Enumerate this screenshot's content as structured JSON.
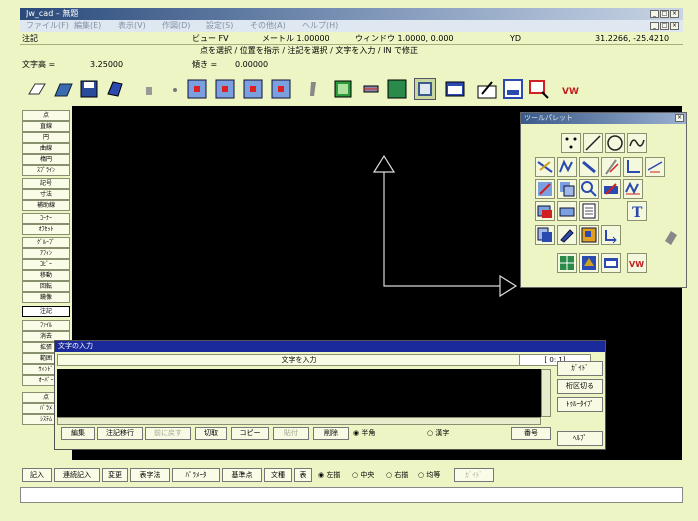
{
  "window": {
    "title": "Jw_cad – 無題",
    "menu": [
      "ファイル(F)",
      "編集(E)",
      "表示(V)",
      "作図(D)",
      "設定(S)",
      "その他(A)",
      "ヘルプ(H)"
    ],
    "min_label": "_",
    "max_label": "□",
    "close_label": "×"
  },
  "status": {
    "mode": "注記",
    "view": "ビュー FV",
    "meter": "メートル 1.00000",
    "window_size": "ウィンドウ 1.0000, 0.000",
    "coords": "31.2266, -25.4210",
    "yd": "YD",
    "prompt": "点を選択 / 位置を指示 / 注記を選択 / 文字を入力 / IN で修正",
    "text_height_label": "文字高 =",
    "text_height": "3.25000",
    "angle_label": "傾き =",
    "angle": "0.00000"
  },
  "toolbar": {
    "buttons": [
      "new-icon",
      "open-icon",
      "save-icon",
      "print-icon",
      "settings-icon",
      "pointer-icon",
      "snap-1-icon",
      "snap-2-icon",
      "snap-3-icon",
      "snap-4-icon",
      "pen-icon",
      "layer-icon",
      "grid-icon",
      "fill-icon",
      "view-icon",
      "window-icon",
      "draw-icon",
      "check-icon",
      "select-icon",
      "vw-icon"
    ],
    "accent": "#d02020"
  },
  "commands": [
    "点",
    "直線",
    "円",
    "曲線",
    "楕円",
    "ｽﾌﾟﾗｲﾝ",
    "記号",
    "寸法",
    "補助線",
    "ｺｰﾅｰ",
    "ｵﾌｾｯﾄ",
    "ｸﾞﾙｰﾌﾟ",
    "ｱﾌｨﾝ",
    "ｺﾋﾟｰ",
    "移動",
    "回転",
    "鏡像",
    "注記",
    "ﾌｧｲﾙ",
    "消去",
    "拡張",
    "範囲",
    "ｳｨﾝﾄﾞ",
    "ｵｰﾊﾞｰ",
    "点",
    "ﾊﾟﾗﾒ",
    "ｼｽﾃﾑ"
  ],
  "active_command": "注記",
  "palette": {
    "title": "ツールパレット",
    "close_label": "×",
    "tools": [
      "point-icon",
      "line-icon",
      "circle-icon",
      "curve-icon",
      "polyline-icon",
      "region-icon",
      "offset-icon",
      "trim-icon",
      "corner-icon",
      "dimension-icon",
      "move-icon",
      "copy-icon",
      "zoom-icon",
      "measure-icon",
      "symbol-icon",
      "layer-icon",
      "fill-icon",
      "hatch-icon",
      "text-icon",
      "print-icon",
      "paste-icon",
      "edit-icon",
      "undo-icon",
      "grid-icon",
      "view-icon",
      "win-icon",
      "vw-icon"
    ],
    "text_tool": "T"
  },
  "text_dialog": {
    "title": "文字の入力",
    "header": "文字を入力",
    "position": "[  0:  1]",
    "buttons": [
      "編集",
      "注記移行",
      "前に戻す",
      "切取",
      "コピー",
      "貼付",
      "削除"
    ],
    "disabled": [
      false,
      false,
      true,
      false,
      false,
      true,
      false
    ],
    "radio_half": "半角",
    "radio_full": "漢字",
    "special": "番号",
    "side_buttons": [
      "ｶﾞｲﾄﾞ",
      "桁区切る",
      "ﾄｩﾙｰﾀｲﾌﾟ"
    ],
    "help_button": "ﾍﾙﾌﾟ"
  },
  "bottombar": {
    "buttons": [
      "記入",
      "連続記入",
      "変更",
      "表字法",
      "ﾊﾟﾗﾒｰﾀ",
      "基準点",
      "文種",
      "表"
    ],
    "radios": [
      "左揃",
      "中央",
      "右揃",
      "均等"
    ],
    "disabled_button": "ｶﾞｲﾄﾞ"
  },
  "canvas": {
    "background": "#000000",
    "axis_color": "#d8d8d8"
  }
}
